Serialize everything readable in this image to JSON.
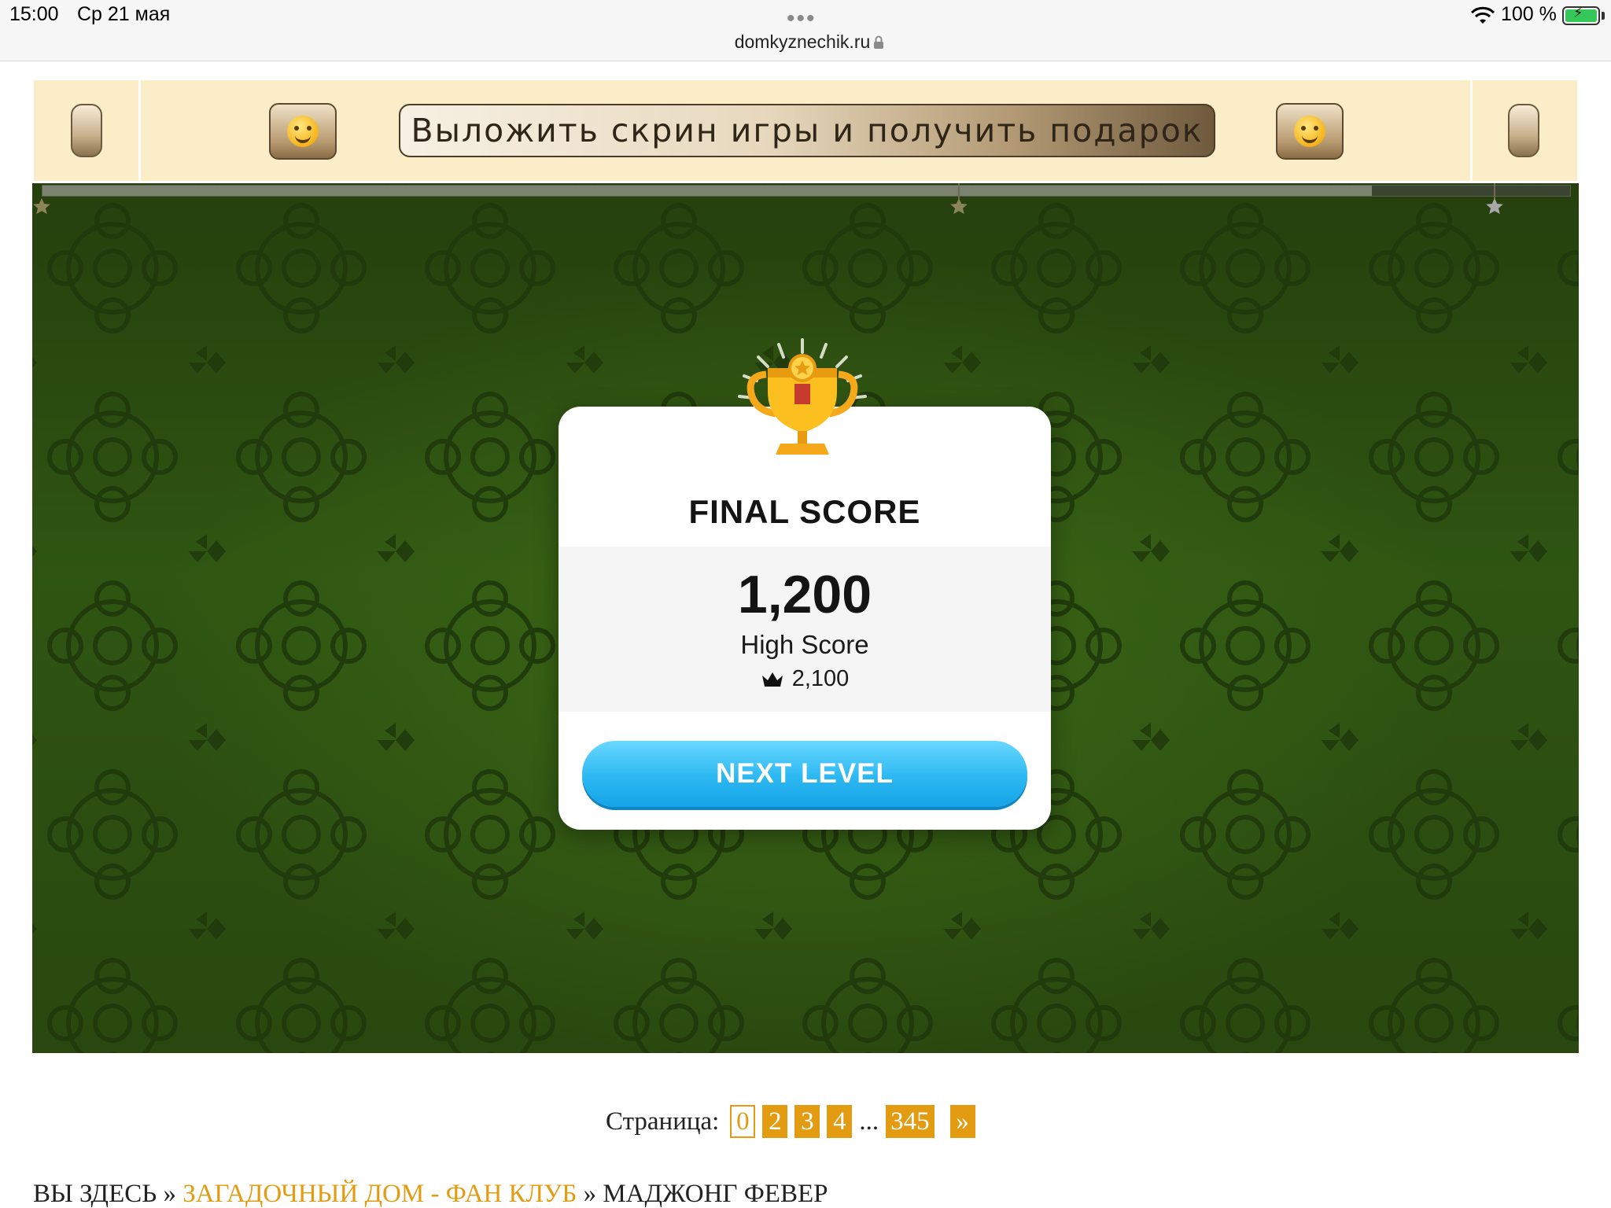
{
  "status_bar": {
    "time": "15:00",
    "date": "Ср 21 мая",
    "url": "domkyznechik.ru",
    "battery": "100 %"
  },
  "banner": {
    "button_label": "Выложить скрин игры и получить подарок",
    "left_emoji": "hugging-face-icon",
    "right_emoji": "hugging-face-icon"
  },
  "game": {
    "progress_fraction": 0.87,
    "stars": [
      "star-1",
      "star-2",
      "star-3"
    ],
    "card": {
      "title": "FINAL SCORE",
      "score": "1,200",
      "high_score_label": "High Score",
      "high_score_value": "2,100",
      "next_button": "NEXT LEVEL"
    },
    "colors": {
      "background": "#2f5512",
      "button": "#2cb8f2"
    }
  },
  "pagination": {
    "label": "Страница:",
    "pages": [
      "0",
      "2",
      "3",
      "4"
    ],
    "ellipsis": "...",
    "last": "345",
    "next": "»"
  },
  "breadcrumb": {
    "prefix": "ВЫ ЗДЕСЬ",
    "sep": "»",
    "link": "ЗАГАДОЧНЫЙ ДОМ - ФАН КЛУБ",
    "current": "МАДЖОНГ ФЕВЕР"
  },
  "colors": {
    "accent": "#e39b12",
    "banner_bg": "#faedc8"
  }
}
